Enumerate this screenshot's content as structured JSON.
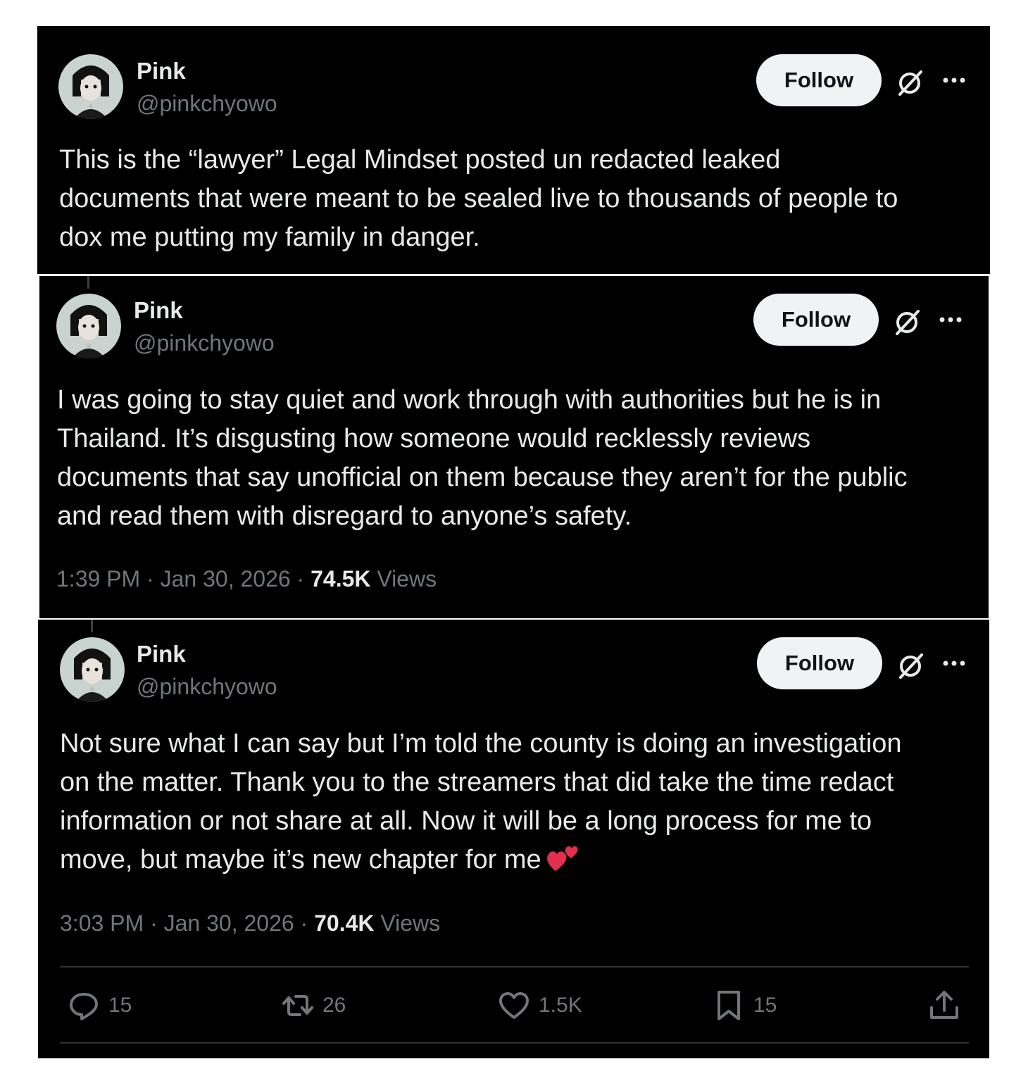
{
  "posts": [
    {
      "name": "Pink",
      "handle": "@pinkchyowo",
      "follow_label": "Follow",
      "text": "This is the  “lawyer” Legal Mindset posted un redacted leaked\ndocuments that were meant to be sealed live to thousands of people to\ndox me putting my family in danger."
    },
    {
      "name": "Pink",
      "handle": "@pinkchyowo",
      "follow_label": "Follow",
      "text": "I was going to stay quiet and work through with authorities but he is in\nThailand. It’s disgusting how someone would recklessly reviews\ndocuments that say unofficial on them because they aren’t for the public\nand read them with disregard to anyone’s safety.",
      "time": "1:39 PM",
      "date": "Jan 30, 2026",
      "views_count": "74.5K",
      "views_label": "Views"
    },
    {
      "name": "Pink",
      "handle": "@pinkchyowo",
      "follow_label": "Follow",
      "text": "Not sure what I can say but I’m told the county is doing an investigation\non the matter. Thank you to the streamers that did take the time redact\ninformation or not share at all. Now it will be a long process for me to\nmove, but maybe it’s new chapter for me",
      "emoji": "two-hearts-icon",
      "time": "3:03 PM",
      "date": "Jan 30, 2026",
      "views_count": "70.4K",
      "views_label": "Views",
      "actions": {
        "replies": "15",
        "reposts": "26",
        "likes": "1.5K",
        "bookmarks": "15"
      }
    }
  ],
  "separator": "·",
  "colors": {
    "background": "#000000",
    "text_primary": "#e7e9ea",
    "text_secondary": "#71767b",
    "follow_button_bg": "#eff3f4",
    "heart_emoji": "#e0304e"
  }
}
